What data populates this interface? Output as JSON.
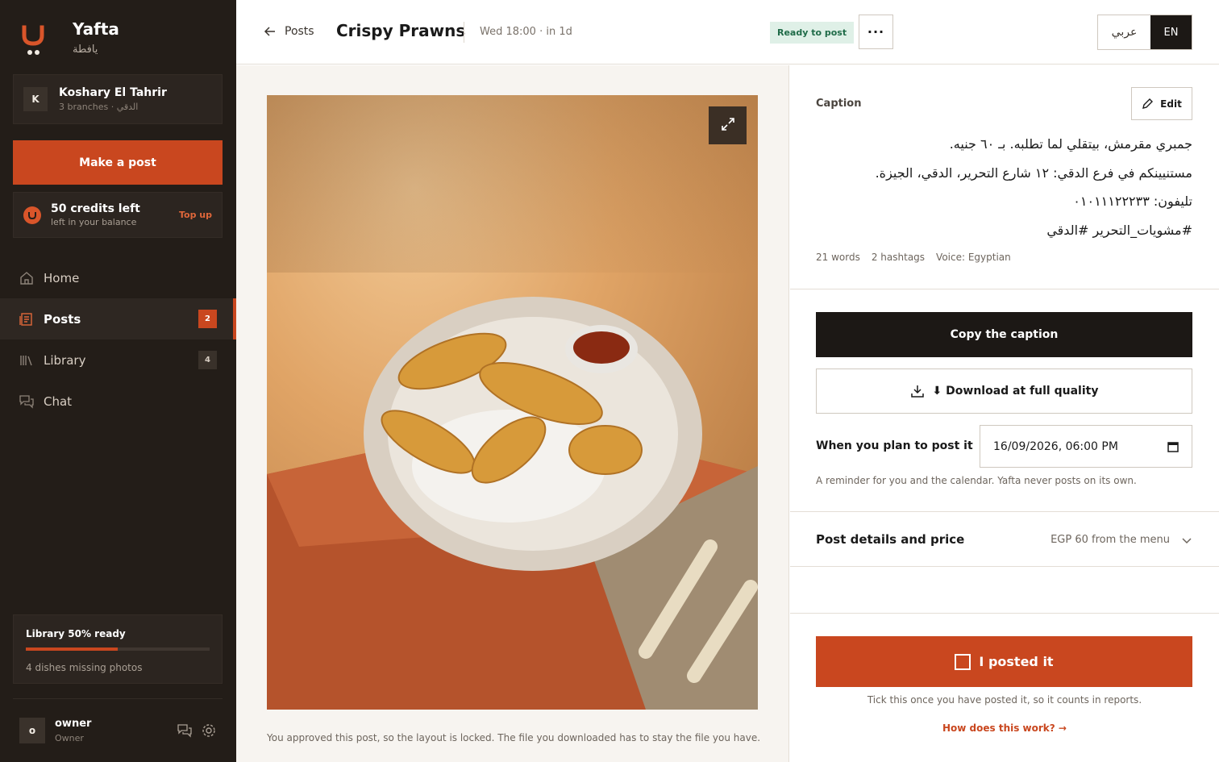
{
  "brand": {
    "name": "Yafta",
    "name_ar": "يافطة"
  },
  "account": {
    "initial": "K",
    "name": "Koshary El Tahrir",
    "sub": "3 branches · الدقي"
  },
  "sidebar": {
    "make_post_label": "Make a post",
    "credits": {
      "title": "50 credits left",
      "sub": "left in your balance",
      "topup_label": "Top up"
    },
    "nav": [
      {
        "label": "Home",
        "icon": "home-icon"
      },
      {
        "label": "Posts",
        "icon": "posts-icon",
        "badge": "2",
        "active": true
      },
      {
        "label": "Library",
        "icon": "library-icon",
        "badge": "4"
      },
      {
        "label": "Chat",
        "icon": "chat-icon"
      }
    ],
    "library_card": {
      "title": "Library 50% ready",
      "progress": 0.5,
      "sub": "4 dishes missing photos"
    },
    "user": {
      "initial": "o",
      "name": "owner",
      "role": "Owner"
    }
  },
  "header": {
    "back_label": "Posts",
    "title": "Crispy Prawns",
    "schedule": "Wed 18:00 · in 1d",
    "status": "Ready to post",
    "more_label": "···",
    "lang_ar": "عربي",
    "lang_en": "EN"
  },
  "preview": {
    "locked_note": "You approved this post, so the layout is locked. The file you downloaded has to stay the file you have."
  },
  "caption": {
    "label": "Caption",
    "edit_label": "Edit",
    "lines": [
      "جمبري مقرمش، بيتقلي لما تطلبه. بـ ٦٠ جنيه.",
      "مستنيينكم في فرع الدقي: ١٢ شارع التحرير، الدقي، الجيزة.",
      "تليفون: ٠١٠١١١٢٢٢٣٣",
      "#مشويات_التحرير #الدقي"
    ],
    "meta": {
      "words": "21 words",
      "hashtags": "2 hashtags",
      "voice": "Voice: Egyptian"
    }
  },
  "actions": {
    "copy_label": "Copy the caption",
    "download_label": "⬇ Download at full quality",
    "plan_label": "When you plan to post it",
    "plan_value": "16/09/2026, 06:00 PM",
    "plan_help": "A reminder for you and the calendar. Yafta never posts on its own."
  },
  "details": {
    "label": "Post details and price",
    "value": "EGP 60 from the menu"
  },
  "posted": {
    "label": "I posted it",
    "help": "Tick this once you have posted it, so it counts in reports.",
    "link": "How does this work? →"
  },
  "colors": {
    "accent": "#c9471f",
    "sidebar_bg": "#231d18",
    "dark_button": "#1c1815",
    "status_bg": "#dff0e7",
    "status_text": "#1f6b48"
  }
}
